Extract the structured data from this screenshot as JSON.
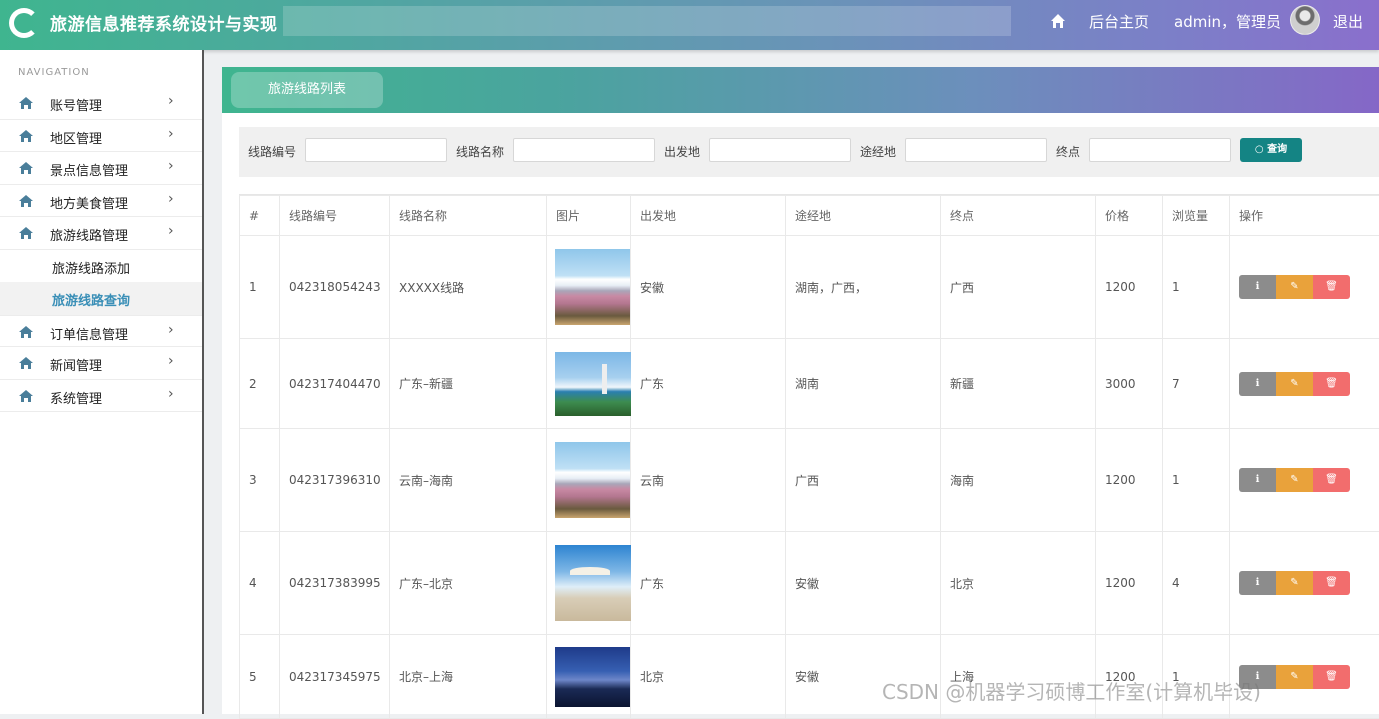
{
  "header": {
    "title": "旅游信息推荐系统设计与实现",
    "nav_home": "后台主页",
    "user": "admin，管理员",
    "logout": "退出"
  },
  "sidebar": {
    "nav_label": "NAVIGATION",
    "items": [
      {
        "label": "账号管理"
      },
      {
        "label": "地区管理"
      },
      {
        "label": "景点信息管理"
      },
      {
        "label": "地方美食管理"
      },
      {
        "label": "旅游线路管理"
      },
      {
        "label": "旅游线路添加"
      },
      {
        "label": "旅游线路查询"
      },
      {
        "label": "订单信息管理"
      },
      {
        "label": "新闻管理"
      },
      {
        "label": "系统管理"
      }
    ],
    "arrow": "›"
  },
  "main": {
    "tab": "旅游线路列表",
    "search": {
      "route_no": "线路编号",
      "route_name": "线路名称",
      "origin": "出发地",
      "via": "途经地",
      "destination": "终点",
      "button": "查询"
    },
    "table": {
      "headers": [
        "#",
        "线路编号",
        "线路名称",
        "图片",
        "出发地",
        "途经地",
        "终点",
        "价格",
        "浏览量",
        "操作"
      ],
      "rows": [
        {
          "idx": "1",
          "no": "042318054243",
          "name": "XXXXX线路",
          "image": "sakura-mountain",
          "origin": "安徽",
          "via": "湖南，广西，",
          "dest": "广西",
          "price": "1200",
          "views": "1"
        },
        {
          "idx": "2",
          "no": "042317404470",
          "name": "广东–新疆",
          "image": "seaside-statue",
          "origin": "广东",
          "via": "湖南",
          "dest": "新疆",
          "price": "3000",
          "views": "7"
        },
        {
          "idx": "3",
          "no": "042317396310",
          "name": "云南–海南",
          "image": "sakura-mountain",
          "origin": "云南",
          "via": "广西",
          "dest": "海南",
          "price": "1200",
          "views": "1"
        },
        {
          "idx": "4",
          "no": "042317383995",
          "name": "广东–北京",
          "image": "beach-umbrella",
          "origin": "广东",
          "via": "安徽",
          "dest": "北京",
          "price": "1200",
          "views": "4"
        },
        {
          "idx": "5",
          "no": "042317345975",
          "name": "北京–上海",
          "image": "night-coast",
          "origin": "北京",
          "via": "安徽",
          "dest": "上海",
          "price": "1200",
          "views": "1"
        }
      ]
    }
  },
  "watermark": "CSDN @机器学习硕博工作室(计算机毕设)"
}
